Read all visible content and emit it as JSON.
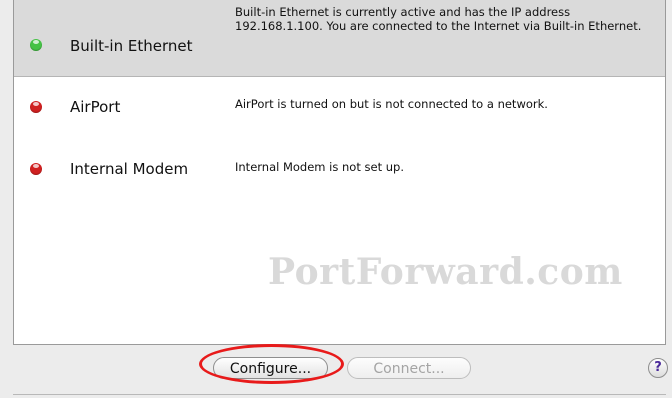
{
  "services": [
    {
      "name": "Built-in Ethernet",
      "status": "active",
      "status_color": "#46c246",
      "description": "Built-in Ethernet is currently active and has the IP address 192.168.1.100. You are connected to the Internet via Built-in Ethernet.",
      "selected": true
    },
    {
      "name": "AirPort",
      "status": "not connected",
      "status_color": "#d02020",
      "description": "AirPort is turned on but is not connected to a network.",
      "selected": false
    },
    {
      "name": "Internal Modem",
      "status": "not set up",
      "status_color": "#d02020",
      "description": "Internal Modem is not set up.",
      "selected": false
    }
  ],
  "watermark": "PortForward.com",
  "buttons": {
    "configure": "Configure...",
    "connect": "Connect...",
    "help": "?"
  },
  "annotation": {
    "highlight_color": "#e81a1a"
  }
}
